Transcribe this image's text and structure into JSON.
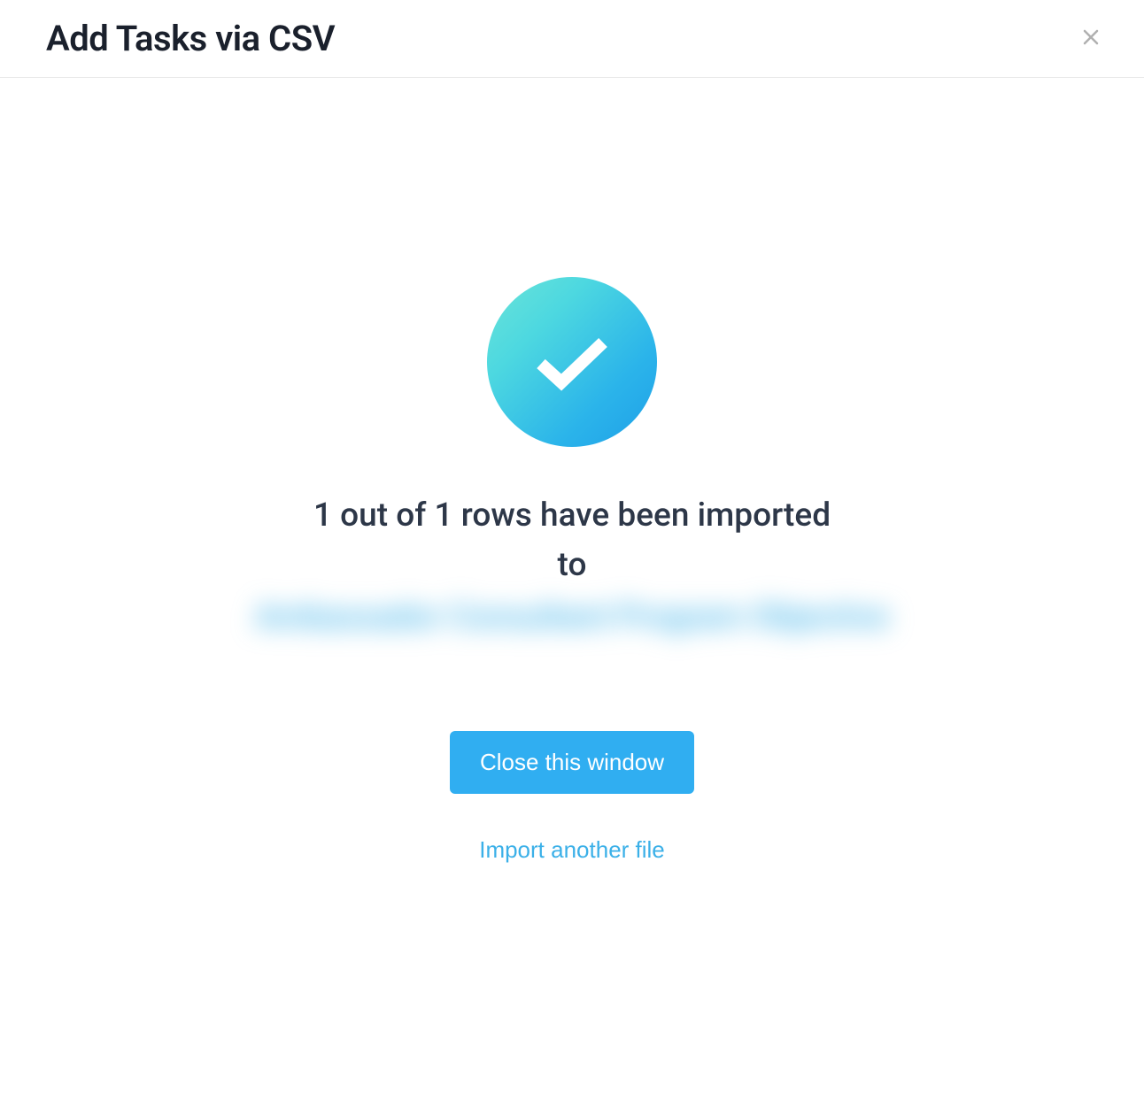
{
  "header": {
    "title": "Add Tasks via CSV"
  },
  "body": {
    "status_message": "1 out of 1 rows have been imported to",
    "destination_name": "Ambassador Consultant Program Objective",
    "close_button_label": "Close this window",
    "import_another_label": "Import another file"
  }
}
